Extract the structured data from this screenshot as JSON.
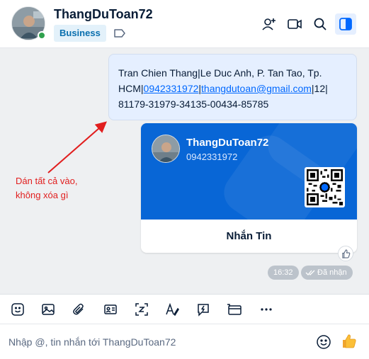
{
  "header": {
    "name": "ThangDuToan72",
    "tag": "Business",
    "icons": [
      "label-icon",
      "add-member-icon",
      "video-call-icon",
      "search-icon",
      "sidebar-toggle-icon"
    ]
  },
  "message": {
    "line1": "Tran Chien Thang|Le Duc Anh, P. Tan Tao, Tp.",
    "line2_prefix": "HCM|",
    "phone_link": "0942331972",
    "sep": "|",
    "email_link": "thangdutoan@gmail.com",
    "line2_suffix": "|12|",
    "line3": "81179-31979-34135-00434-85785"
  },
  "card": {
    "name": "ThangDuToan72",
    "phone": "0942331972",
    "button_label": "Nhắn Tin"
  },
  "meta": {
    "time": "16:32",
    "status": "Đã nhận"
  },
  "annotation": {
    "line1": "Dán tất cả vào,",
    "line2": "không xóa gì",
    "color": "#e11e1e"
  },
  "toolbar": {
    "icons": [
      "sticker-icon",
      "image-icon",
      "attachment-icon",
      "contact-card-icon",
      "screenshot-icon",
      "text-format-icon",
      "quick-message-icon",
      "payment-icon",
      "more-icon"
    ]
  },
  "composer": {
    "placeholder": "Nhập @, tin nhắn tới ThangDuToan72",
    "value": ""
  },
  "colors": {
    "accent": "#0068ff",
    "card_blue": "#0866d6",
    "bubble": "#e5efff",
    "chat_bg": "#eef0f2"
  }
}
